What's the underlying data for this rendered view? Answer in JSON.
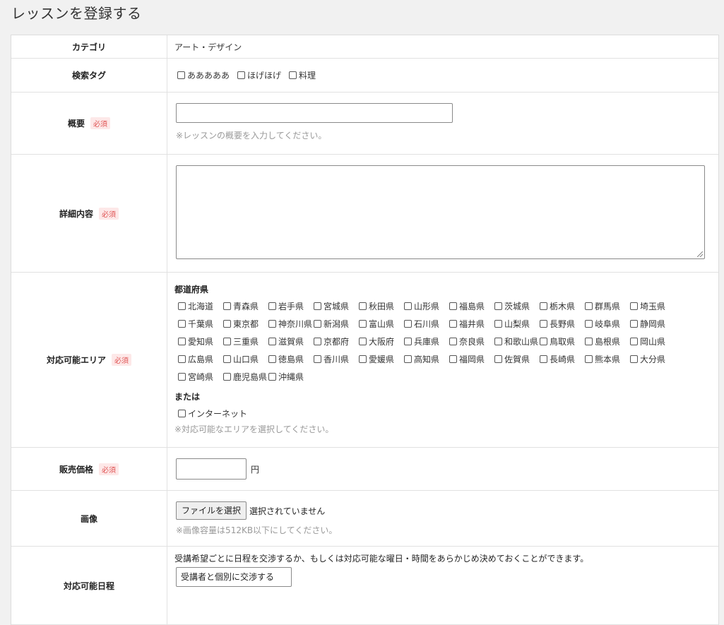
{
  "page_title": "レッスンを登録する",
  "required_badge": "必須",
  "category": {
    "label": "カテゴリ",
    "value": "アート・デザイン"
  },
  "tags": {
    "label": "検索タグ",
    "options": [
      "あああああ",
      "ほげほげ",
      "料理"
    ]
  },
  "summary": {
    "label": "概要",
    "hint": "※レッスンの概要を入力してください。",
    "value": ""
  },
  "detail": {
    "label": "詳細内容",
    "value": ""
  },
  "area": {
    "label": "対応可能エリア",
    "prefectures_heading": "都道府県",
    "prefectures": [
      "北海道",
      "青森県",
      "岩手県",
      "宮城県",
      "秋田県",
      "山形県",
      "福島県",
      "茨城県",
      "栃木県",
      "群馬県",
      "埼玉県",
      "千葉県",
      "東京都",
      "神奈川県",
      "新潟県",
      "富山県",
      "石川県",
      "福井県",
      "山梨県",
      "長野県",
      "岐阜県",
      "静岡県",
      "愛知県",
      "三重県",
      "滋賀県",
      "京都府",
      "大阪府",
      "兵庫県",
      "奈良県",
      "和歌山県",
      "鳥取県",
      "島根県",
      "岡山県",
      "広島県",
      "山口県",
      "徳島県",
      "香川県",
      "愛媛県",
      "高知県",
      "福岡県",
      "佐賀県",
      "長崎県",
      "熊本県",
      "大分県",
      "宮崎県",
      "鹿児島県",
      "沖縄県"
    ],
    "or_label": "または",
    "internet_label": "インターネット",
    "hint": "※対応可能なエリアを選択してください。"
  },
  "price": {
    "label": "販売価格",
    "unit": "円",
    "value": ""
  },
  "image": {
    "label": "画像",
    "button": "ファイルを選択",
    "status": "選択されていません",
    "hint": "※画像容量は512KB以下にしてください。"
  },
  "schedule": {
    "label": "対応可能日程",
    "description": "受講希望ごとに日程を交渉するか、もしくは対応可能な曜日・時間をあらかじめ決めておくことができます。",
    "selected": "受講者と個別に交渉する"
  }
}
